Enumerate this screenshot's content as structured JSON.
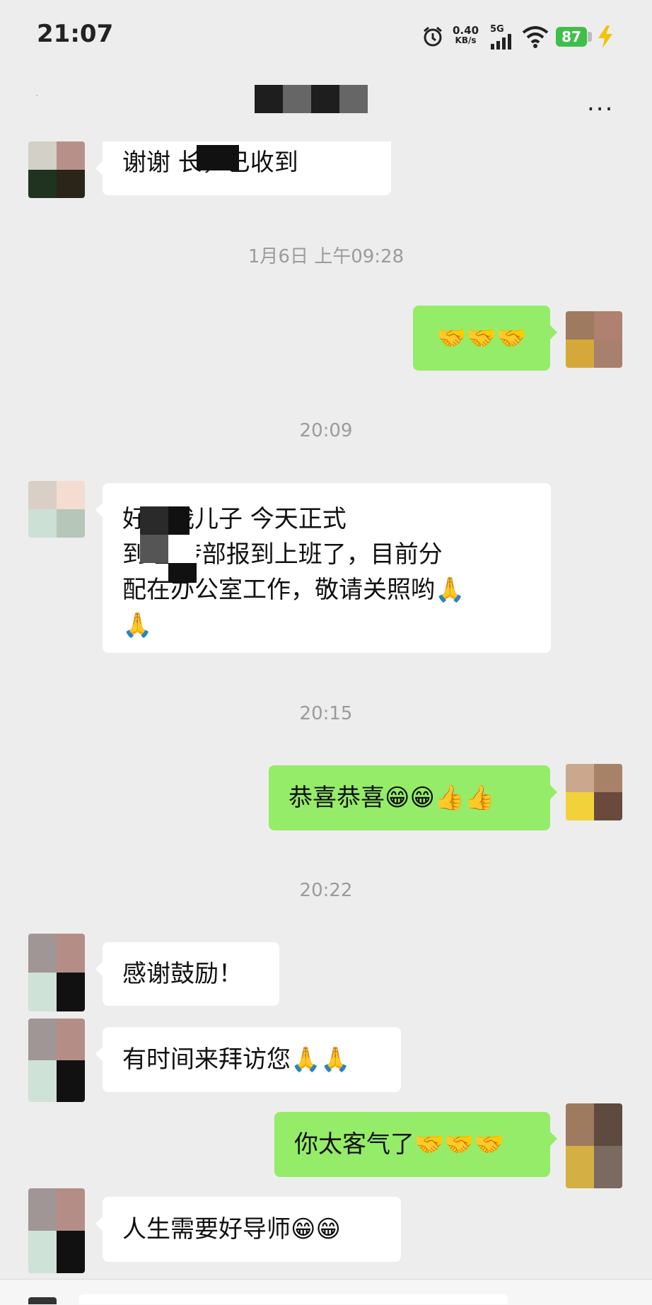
{
  "status_bar": {
    "time": "21:07",
    "net_speed": "0.40",
    "net_unit": "KB/s",
    "network": "5G",
    "battery": "87"
  },
  "header": {
    "more_label": "..."
  },
  "messages": [
    {
      "side": "left",
      "text": "谢谢      长，已收到"
    },
    {
      "side": "time",
      "text": "1月6日 上午09:28"
    },
    {
      "side": "right",
      "text": "🤝🤝🤝"
    },
    {
      "side": "time",
      "text": "20:09"
    },
    {
      "side": "left",
      "line1": "      好！我儿子     今天正式",
      "line2": "到    宣传部报到上班了，目前分",
      "line3": "配在办公室工作，敬请关照哟🙏",
      "line4": "🙏"
    },
    {
      "side": "time",
      "text": "20:15"
    },
    {
      "side": "right",
      "text": "恭喜恭喜😁😁👍👍"
    },
    {
      "side": "time",
      "text": "20:22"
    },
    {
      "side": "left",
      "text": "感谢鼓励！"
    },
    {
      "side": "left",
      "text": "有时间来拜访您🙏🙏"
    },
    {
      "side": "right",
      "text": "你太客气了🤝🤝🤝"
    },
    {
      "side": "left",
      "text": "人生需要好导师😁😁"
    }
  ],
  "colors": {
    "right_bubble": "#95ec69",
    "left_bubble": "#ffffff",
    "background": "#ededed",
    "timestamp": "#9b9b9b"
  }
}
